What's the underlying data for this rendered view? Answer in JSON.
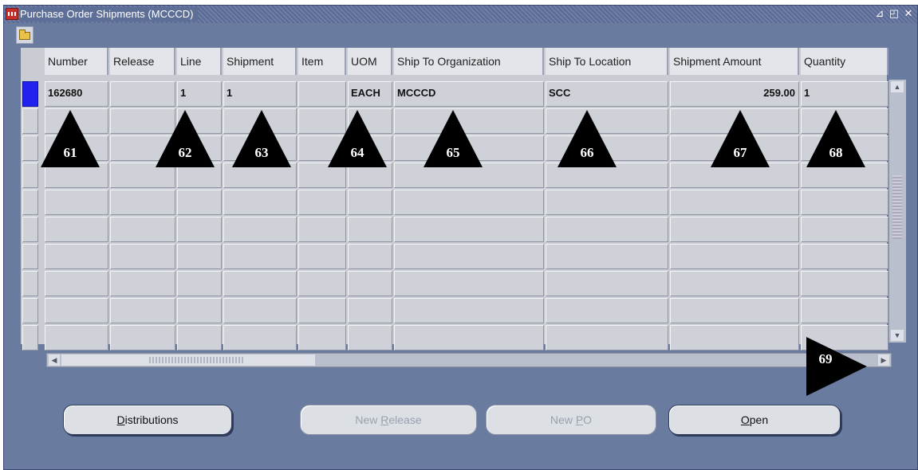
{
  "window": {
    "title": "Purchase Order Shipments (MCCCD)",
    "controls": [
      "minimize",
      "maximize",
      "close"
    ]
  },
  "table": {
    "columns": [
      "Number",
      "Release",
      "Line",
      "Shipment",
      "Item",
      "UOM",
      "Ship To Organization",
      "Ship To Location",
      "Shipment Amount",
      "Quantity"
    ],
    "rows": [
      [
        "162680",
        "",
        "1",
        "1",
        "",
        "EACH",
        "MCCCD",
        "SCC",
        "259.00",
        "1"
      ],
      [
        "",
        "",
        "",
        "",
        "",
        "",
        "",
        "",
        "",
        ""
      ],
      [
        "",
        "",
        "",
        "",
        "",
        "",
        "",
        "",
        "",
        ""
      ],
      [
        "",
        "",
        "",
        "",
        "",
        "",
        "",
        "",
        "",
        ""
      ],
      [
        "",
        "",
        "",
        "",
        "",
        "",
        "",
        "",
        "",
        ""
      ],
      [
        "",
        "",
        "",
        "",
        "",
        "",
        "",
        "",
        "",
        ""
      ],
      [
        "",
        "",
        "",
        "",
        "",
        "",
        "",
        "",
        "",
        ""
      ],
      [
        "",
        "",
        "",
        "",
        "",
        "",
        "",
        "",
        "",
        ""
      ],
      [
        "",
        "",
        "",
        "",
        "",
        "",
        "",
        "",
        "",
        ""
      ],
      [
        "",
        "",
        "",
        "",
        "",
        "",
        "",
        "",
        "",
        ""
      ]
    ]
  },
  "buttons": {
    "distributions": {
      "label_pre": "",
      "mnemonic": "D",
      "label_post": "istributions"
    },
    "new_release": {
      "label_pre": "New ",
      "mnemonic": "R",
      "label_post": "elease"
    },
    "new_po": {
      "label_pre": "New ",
      "mnemonic": "P",
      "label_post": "O"
    },
    "open": {
      "label_pre": "",
      "mnemonic": "O",
      "label_post": "pen"
    }
  },
  "markers": [
    "61",
    "62",
    "63",
    "64",
    "65",
    "66",
    "67",
    "68",
    "69"
  ],
  "colors": {
    "window_bg": "#6a7ba0",
    "selected_row": "#2222ee",
    "marker": "#000000"
  }
}
